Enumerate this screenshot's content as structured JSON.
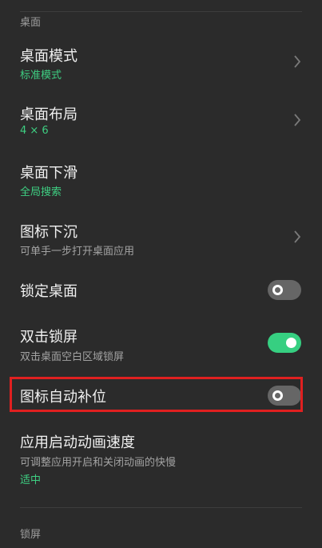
{
  "sections": {
    "desktop": "桌面",
    "lockscreen": "锁屏"
  },
  "items": [
    {
      "title": "桌面模式",
      "subtitle": "标准模式",
      "control": "chevron-right-icon"
    },
    {
      "title": "桌面布局",
      "subtitle": "4 × 6",
      "control": "chevron-right-icon"
    },
    {
      "title": "桌面下滑",
      "subtitle": "全局搜索"
    },
    {
      "title": "图标下沉",
      "subtitle": "可单手一步打开桌面应用",
      "control": "chevron-right-icon"
    },
    {
      "title": "锁定桌面",
      "toggle": false
    },
    {
      "title": "双击锁屏",
      "subtitle": "双击桌面空白区域锁屏",
      "toggle": true
    },
    {
      "title": "图标自动补位",
      "toggle": false,
      "highlighted": true
    },
    {
      "title": "应用启动动画速度",
      "subtitle": "可调整应用开启和关闭动画的快慢",
      "value": "适中"
    }
  ],
  "colors": {
    "background": "#2b2b2b",
    "accent": "#36cf81",
    "highlight": "#e02020"
  }
}
